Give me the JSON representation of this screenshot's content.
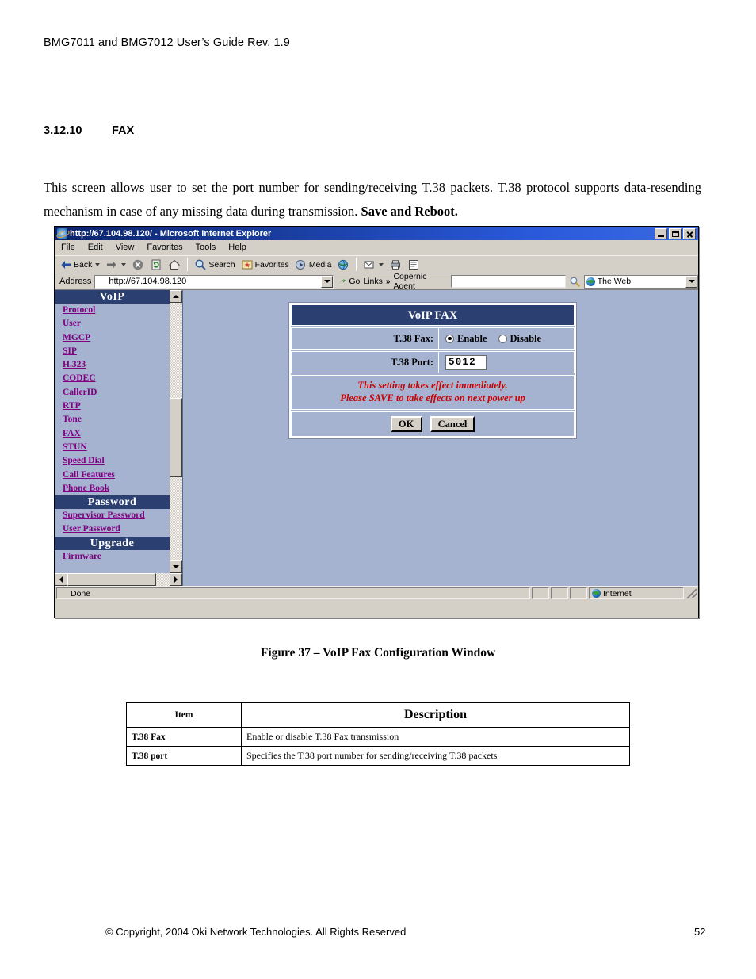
{
  "document": {
    "header": "BMG7011 and BMG7012 User’s Guide Rev. 1.9",
    "section_number": "3.12.10",
    "section_title": "FAX",
    "paragraph_part1": "This screen allows user to set the port number for sending/receiving T.38 packets. T.38 protocol supports data-resending mechanism in case of any missing data during transmission. ",
    "paragraph_bold": "Save and Reboot.",
    "figure_caption": "Figure 37 – VoIP Fax Configuration Window",
    "footer_copyright": "© Copyright, 2004 Oki Network Technologies. All Rights Reserved",
    "page_number": "52"
  },
  "browser": {
    "title": "http://67.104.98.120/ - Microsoft Internet Explorer",
    "menu": [
      "File",
      "Edit",
      "View",
      "Favorites",
      "Tools",
      "Help"
    ],
    "toolbar": {
      "back": "Back",
      "forward": "",
      "stop": "",
      "refresh": "",
      "home": "",
      "search": "Search",
      "favorites": "Favorites",
      "media": "Media",
      "history": "",
      "mail": "",
      "print": "",
      "edit": ""
    },
    "address": {
      "label": "Address",
      "value": "http://67.104.98.120",
      "go_label": "Go",
      "links_label": "Links",
      "overflow_label": "»"
    },
    "copernic": {
      "label": "Copernic Agent",
      "query": "",
      "query_placeholder": "",
      "scope": "The Web"
    },
    "status": {
      "text": "Done",
      "zone": "Internet"
    },
    "window_controls": {
      "minimize": "Minimize",
      "maximize": "Maximize",
      "close": "Close"
    }
  },
  "sidebar": {
    "groups": [
      {
        "header": "VoIP",
        "items": [
          "Protocol",
          "User",
          "MGCP",
          "SIP",
          "H.323",
          "CODEC",
          "CallerID",
          "RTP",
          "Tone",
          "FAX",
          "STUN",
          "Speed Dial",
          "Call Features",
          "Phone Book"
        ]
      },
      {
        "header": "Password",
        "items": [
          "Supervisor Password",
          "User Password"
        ]
      },
      {
        "header": "Upgrade",
        "items": [
          "Firmware"
        ]
      }
    ]
  },
  "fax_panel": {
    "title": "VoIP FAX",
    "rows": [
      {
        "label": "T.38 Fax:",
        "type": "radio",
        "options": [
          "Enable",
          "Disable"
        ],
        "selected": "Enable"
      },
      {
        "label": "T.38 Port:",
        "type": "text",
        "value": "5012"
      }
    ],
    "note_line1": "This setting takes effect immediately.",
    "note_line2": "Please SAVE to take effects on next power up",
    "ok_label": "OK",
    "cancel_label": "Cancel"
  },
  "table": {
    "headers": [
      "Item",
      "Description"
    ],
    "rows": [
      [
        "T.38 Fax",
        "Enable or disable T.38 Fax transmission"
      ],
      [
        "T.38 port",
        "Specifies the T.38 port number for sending/receiving T.38 packets"
      ]
    ]
  },
  "colors": {
    "nav_header_bg": "#2b4070",
    "page_bg": "#a5b2d0",
    "link": "#800080",
    "note_text": "#cc0000",
    "titlebar": "#0a246a"
  }
}
